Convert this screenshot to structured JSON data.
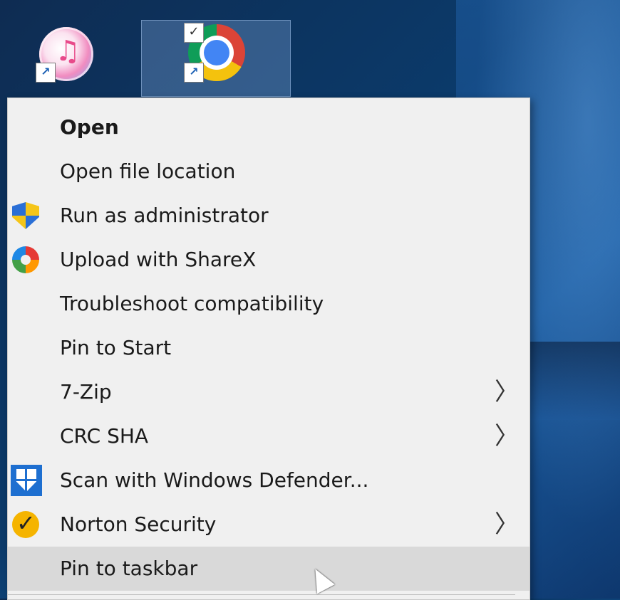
{
  "desktop": {
    "icons": [
      {
        "name": "iTunes",
        "icon": "itunes-icon"
      },
      {
        "name": "Google Chrome",
        "icon": "chrome-icon",
        "selected": true
      }
    ]
  },
  "context_menu": {
    "items": [
      {
        "label": "Open",
        "bold": true,
        "icon": null,
        "submenu": false
      },
      {
        "label": "Open file location",
        "icon": null,
        "submenu": false
      },
      {
        "label": "Run as administrator",
        "icon": "uac-shield-icon",
        "submenu": false
      },
      {
        "label": "Upload with ShareX",
        "icon": "sharex-icon",
        "submenu": false
      },
      {
        "label": "Troubleshoot compatibility",
        "icon": null,
        "submenu": false
      },
      {
        "label": "Pin to Start",
        "icon": null,
        "submenu": false
      },
      {
        "label": "7-Zip",
        "icon": null,
        "submenu": true
      },
      {
        "label": "CRC SHA",
        "icon": null,
        "submenu": true
      },
      {
        "label": "Scan with Windows Defender...",
        "icon": "windows-defender-icon",
        "submenu": false
      },
      {
        "label": "Norton Security",
        "icon": "norton-icon",
        "submenu": true
      },
      {
        "label": "Pin to taskbar",
        "icon": null,
        "submenu": false,
        "hovered": true
      }
    ],
    "chevron": "〉"
  },
  "colors": {
    "menu_bg": "#f0f0f0",
    "hover_bg": "#d9d9d9",
    "desktop_bg": "#0b3a6a"
  }
}
